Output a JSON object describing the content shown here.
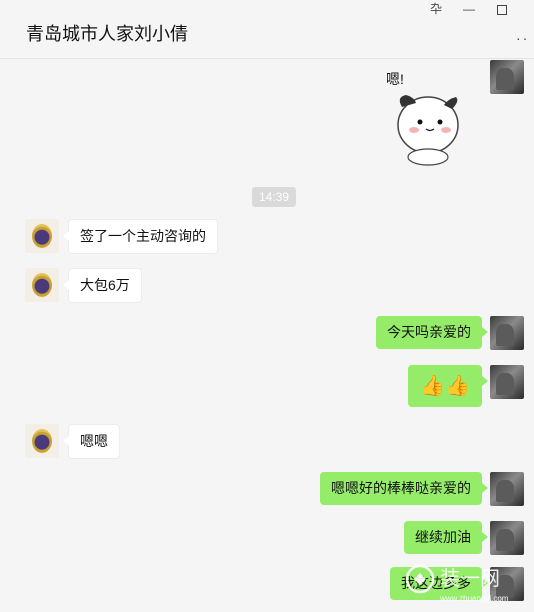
{
  "window": {
    "title": "青岛城市人家刘小倩",
    "pin_icon": "pin-icon",
    "minimize_icon": "minimize-icon",
    "maximize_icon": "maximize-icon",
    "more_icon": "more-icon"
  },
  "chat": {
    "sticker": {
      "text": "嗯!"
    },
    "timestamp": "14:39",
    "messages": [
      {
        "side": "left",
        "text": "签了一个主动咨询的"
      },
      {
        "side": "left",
        "text": "大包6万"
      },
      {
        "side": "right",
        "text": "今天吗亲爱的"
      },
      {
        "side": "right",
        "text": "👍👍"
      },
      {
        "side": "left",
        "text": "嗯嗯"
      },
      {
        "side": "right",
        "text": "嗯嗯好的棒棒哒亲爱的"
      },
      {
        "side": "right",
        "text": "继续加油"
      },
      {
        "side": "right",
        "text": "我这边多多"
      }
    ]
  },
  "watermark": {
    "text": "装一网",
    "subtext": "www.zhuangyi.com"
  },
  "colors": {
    "bubble_self": "#95ec69",
    "bubble_other": "#ffffff",
    "background": "#f5f5f5"
  }
}
